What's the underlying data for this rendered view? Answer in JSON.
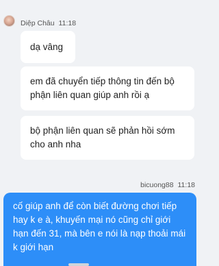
{
  "thread": {
    "contact": {
      "name": "Diệp Châu",
      "time": "11:18"
    },
    "incoming_messages": [
      "dạ vâng",
      "em đã chuyển tiếp thông tin đến bộ phận liên quan giúp anh rồi ạ",
      "bộ phận liên quan sẽ phản hồi sớm cho anh nha"
    ],
    "me": {
      "name": "bicuong88",
      "time": "11:18"
    },
    "outgoing_message": "cố giúp anh để còn biết đường chơi tiếp hay k e à, khuyến mại nó cũng chỉ giới hạn đến 31, mà bên e nói là nạp thoải mái k giới hạn"
  },
  "colors": {
    "outgoing_bubble": "#2d8ef8",
    "incoming_bubble": "#ffffff",
    "background": "#f0f2f5"
  }
}
